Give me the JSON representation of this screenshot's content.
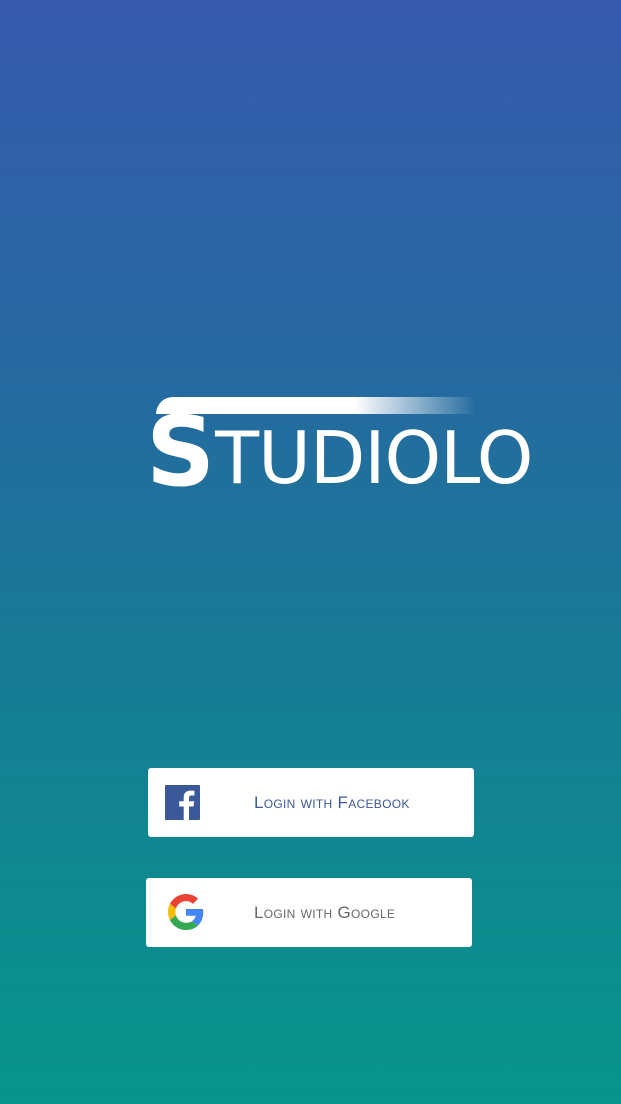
{
  "app": {
    "logo_text_initial": "S",
    "logo_text_rest": "TUDIOLO"
  },
  "login": {
    "facebook_label": "Login with Facebook",
    "google_label": "Login with Google"
  },
  "icons": {
    "facebook": "facebook-f-icon",
    "google": "google-g-icon"
  },
  "colors": {
    "background_top": "#3659ad",
    "background_bottom": "#06958a",
    "facebook_blue": "#3b5899",
    "button_bg": "#ffffff"
  }
}
